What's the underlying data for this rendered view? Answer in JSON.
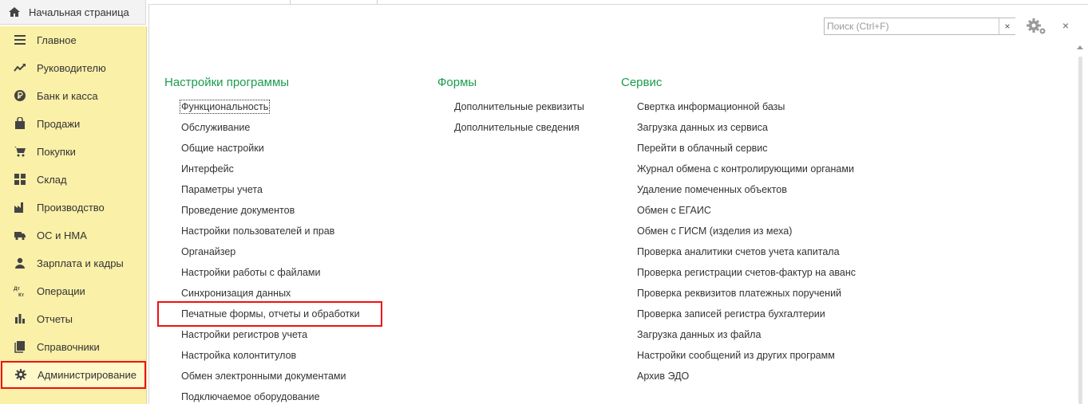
{
  "top_tabs": {
    "home_label": "Начальная страница"
  },
  "sidebar": {
    "items": [
      {
        "label": "Главное",
        "icon": "menu-icon"
      },
      {
        "label": "Руководителю",
        "icon": "trend-icon"
      },
      {
        "label": "Банк и касса",
        "icon": "ruble-icon"
      },
      {
        "label": "Продажи",
        "icon": "shopping-bag-icon"
      },
      {
        "label": "Покупки",
        "icon": "cart-icon"
      },
      {
        "label": "Склад",
        "icon": "warehouse-icon"
      },
      {
        "label": "Производство",
        "icon": "factory-icon"
      },
      {
        "label": "ОС и НМА",
        "icon": "truck-icon"
      },
      {
        "label": "Зарплата и кадры",
        "icon": "person-icon"
      },
      {
        "label": "Операции",
        "icon": "dt-kt-icon"
      },
      {
        "label": "Отчеты",
        "icon": "bar-chart-icon"
      },
      {
        "label": "Справочники",
        "icon": "books-icon"
      },
      {
        "label": "Администрирование",
        "icon": "gear-icon"
      }
    ],
    "active": "Администрирование"
  },
  "search": {
    "placeholder": "Поиск (Ctrl+F)",
    "clear": "×"
  },
  "window": {
    "close": "×"
  },
  "columns": {
    "settings": {
      "title": "Настройки программы",
      "links": [
        "Функциональность",
        "Обслуживание",
        "Общие настройки",
        "Интерфейс",
        "Параметры учета",
        "Проведение документов",
        "Настройки пользователей и прав",
        "Органайзер",
        "Настройки работы с файлами",
        "Синхронизация данных",
        "Печатные формы, отчеты и обработки",
        "Настройки регистров учета",
        "Настройка колонтитулов",
        "Обмен электронными документами",
        "Подключаемое оборудование"
      ]
    },
    "forms": {
      "title": "Формы",
      "links": [
        "Дополнительные реквизиты",
        "Дополнительные сведения"
      ]
    },
    "service": {
      "title": "Сервис",
      "links": [
        "Свертка информационной базы",
        "Загрузка данных из сервиса",
        "Перейти в облачный сервис",
        "Журнал обмена с контролирующими органами",
        "Удаление помеченных объектов",
        "Обмен с ЕГАИС",
        "Обмен с ГИСМ (изделия из меха)",
        "Проверка аналитики счетов учета капитала",
        "Проверка регистрации счетов-фактур на аванс",
        "Проверка реквизитов платежных поручений",
        "Проверка записей регистра бухгалтерии",
        "Загрузка данных из файла",
        "Настройки сообщений из других программ",
        "Архив ЭДО"
      ]
    }
  },
  "colors": {
    "sidebar_bg": "#faf0a8",
    "section_title": "#1a9c4c",
    "highlight": "#ee1111"
  }
}
